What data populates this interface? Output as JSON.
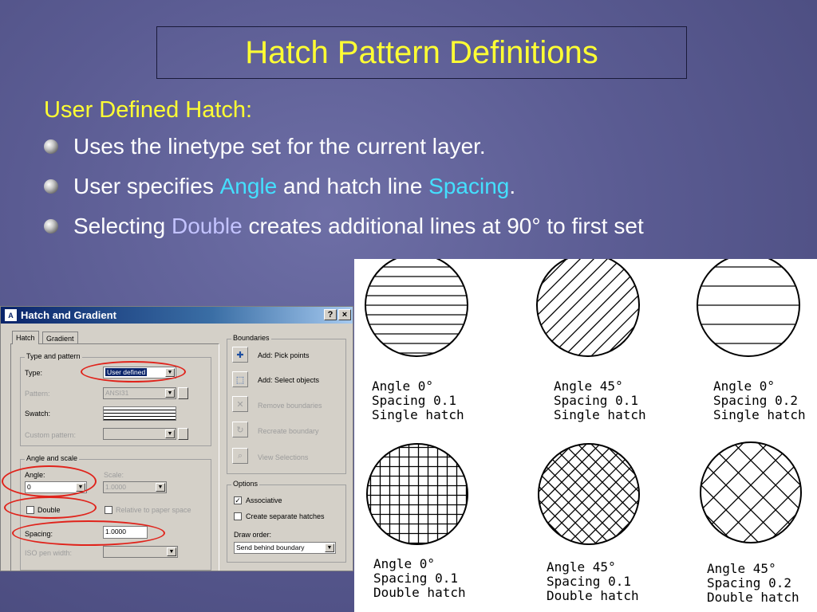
{
  "slide": {
    "title": "Hatch Pattern Definitions",
    "subheading": "User Defined Hatch:",
    "bullets": [
      {
        "text": "Uses the linetype set for the current layer."
      },
      {
        "pre": "User specifies ",
        "hl1": "Angle",
        "mid": " and hatch line ",
        "hl2": "Spacing",
        "post": "."
      },
      {
        "pre": "Selecting ",
        "hl1": "Double",
        "post": " creates additional lines at 90° to first set"
      }
    ],
    "colors": {
      "title": "#ffff33",
      "highlight": "#44e0ff",
      "highlight2": "#c3c3ff",
      "text": "#ffffff"
    }
  },
  "dialog": {
    "title": "Hatch and Gradient",
    "help_btn": "?",
    "close_btn": "×",
    "tabs": [
      "Hatch",
      "Gradient"
    ],
    "type_and_pattern": {
      "group": "Type and pattern",
      "type_label": "Type:",
      "type_value": "User defined",
      "pattern_label": "Pattern:",
      "pattern_value": "ANSI31",
      "swatch_label": "Swatch:",
      "custom_label": "Custom pattern:"
    },
    "angle_and_scale": {
      "group": "Angle and scale",
      "angle_label": "Angle:",
      "angle_value": "0",
      "scale_label": "Scale:",
      "scale_value": "1.0000",
      "double_label": "Double",
      "relative_label": "Relative to paper space",
      "spacing_label": "Spacing:",
      "spacing_value": "1.0000",
      "iso_label": "ISO pen width:"
    },
    "boundaries": {
      "group": "Boundaries",
      "items": [
        "Add: Pick points",
        "Add: Select objects",
        "Remove boundaries",
        "Recreate boundary",
        "View Selections"
      ]
    },
    "options": {
      "group": "Options",
      "associative": "Associative",
      "separate": "Create separate hatches",
      "draw_order_label": "Draw order:",
      "draw_order_value": "Send behind boundary"
    }
  },
  "examples": [
    {
      "angle_line": "Angle 0°",
      "spacing_line": "Spacing 0.1",
      "type_line": "Single hatch"
    },
    {
      "angle_line": "Angle 45°",
      "spacing_line": "Spacing 0.1",
      "type_line": "Single hatch"
    },
    {
      "angle_line": "Angle 0°",
      "spacing_line": "Spacing 0.2",
      "type_line": "Single hatch"
    },
    {
      "angle_line": "Angle 0°",
      "spacing_line": "Spacing 0.1",
      "type_line": "Double hatch"
    },
    {
      "angle_line": "Angle 45°",
      "spacing_line": "Spacing 0.1",
      "type_line": "Double hatch"
    },
    {
      "angle_line": "Angle 45°",
      "spacing_line": "Spacing 0.2",
      "type_line": "Double hatch"
    }
  ]
}
